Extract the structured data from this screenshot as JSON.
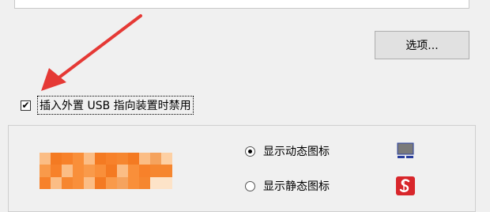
{
  "options_button": {
    "label": "选项..."
  },
  "checkbox": {
    "label": "插入外置 USB 指向装置时禁用",
    "checked": true,
    "check_glyph": "✔"
  },
  "pointer_icon": {
    "options": [
      {
        "label": "显示动态图标",
        "selected": true,
        "icon": "touchpad-icon"
      },
      {
        "label": "显示静态图标",
        "selected": false,
        "icon": "synaptics-icon"
      }
    ]
  },
  "colors": {
    "annotation_arrow": "#e53935",
    "redacted_orange": "#f7812a",
    "static_icon_red": "#d8262b",
    "dynamic_icon_gray": "#7a7a7a",
    "dynamic_icon_blue": "#2a3f9e"
  }
}
